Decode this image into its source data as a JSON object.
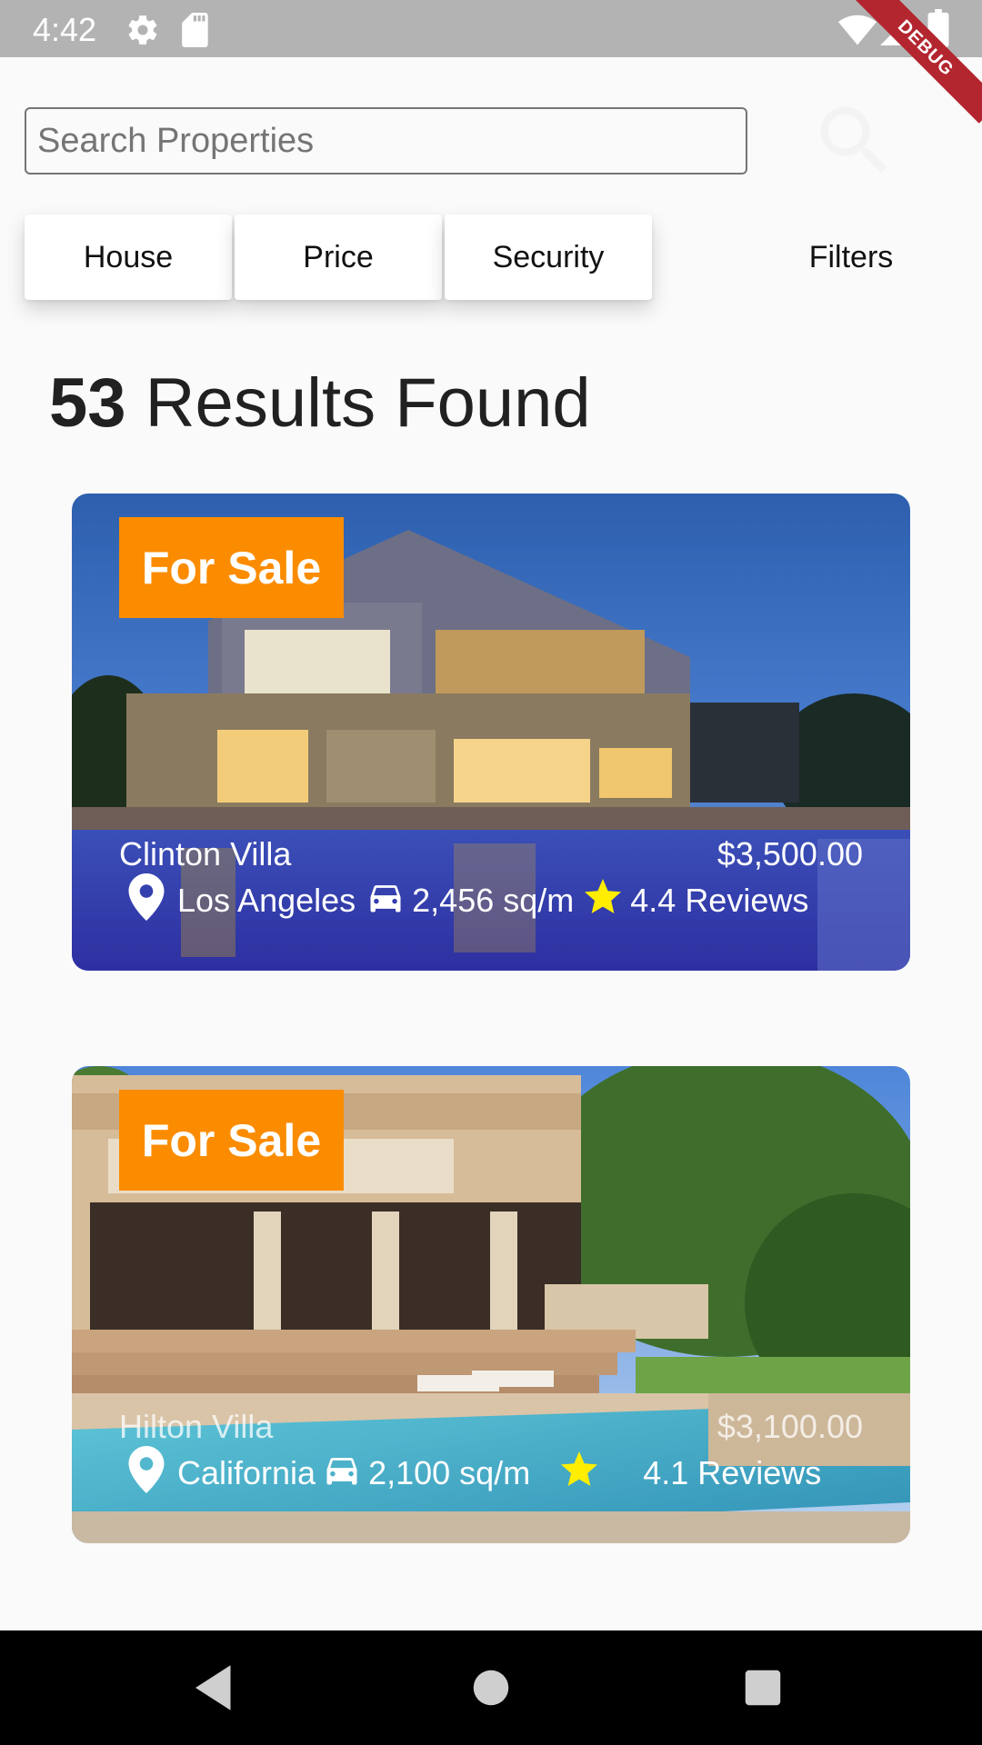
{
  "status_bar": {
    "time": "4:42",
    "icons": [
      "gear-icon",
      "sd-card-icon",
      "wifi-icon",
      "signal-icon",
      "battery-icon"
    ],
    "debug_label": "DEBUG"
  },
  "search": {
    "placeholder": "Search Properties",
    "icon": "search-icon"
  },
  "filter_chips": [
    {
      "label": "House"
    },
    {
      "label": "Price"
    },
    {
      "label": "Security"
    }
  ],
  "filters_button": {
    "label": "Filters"
  },
  "results": {
    "count": "53",
    "label": "Results Found"
  },
  "properties": [
    {
      "tag": "For Sale",
      "name": "Clinton Villa",
      "price": "$3,500.00",
      "location": "Los Angeles",
      "area": "2,456 sq/m",
      "reviews": "4.4 Reviews"
    },
    {
      "tag": "For Sale",
      "name": "Hilton Villa",
      "price": "$3,100.00",
      "location": "California",
      "area": "2,100 sq/m",
      "reviews": "4.1 Reviews"
    }
  ],
  "colors": {
    "tag_background": "#fb8c00",
    "star": "#ffee00",
    "status_bar": "#b3b3b3",
    "debug_ribbon": "#b3262f"
  },
  "nav_bar": {
    "icons": [
      "back-icon",
      "home-icon",
      "recents-icon"
    ]
  }
}
